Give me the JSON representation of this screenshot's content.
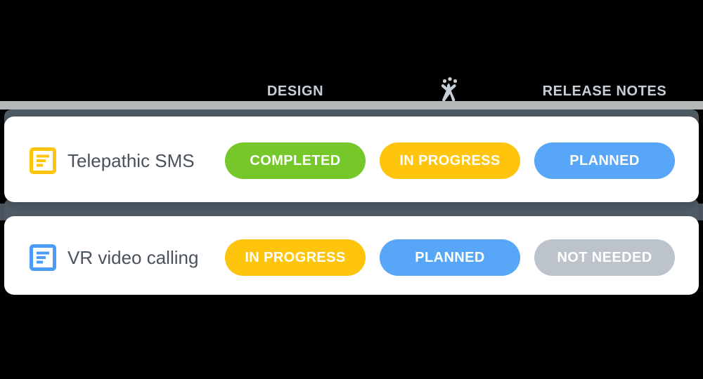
{
  "header": {
    "columns": [
      {
        "label": "DESIGN",
        "icon": "juggling-person-icon"
      },
      {
        "label": "",
        "icon": "juggling-person-icon"
      },
      {
        "label": "RELEASE NOTES",
        "icon": ""
      }
    ],
    "column_1_label": "DESIGN",
    "column_2_label": "",
    "column_3_label": "RELEASE NOTES",
    "center_icon_name": "juggling-person-icon",
    "text_color": "#c6ced6",
    "band_color": "#b5b8b9"
  },
  "theme": {
    "background": "#000000",
    "card_background": "#ffffff",
    "slate_bar": "#4e5a64",
    "title_color": "#4a525c",
    "status_completed": "#76c82a",
    "status_in_progress": "#ffc40c",
    "status_planned": "#57a6f7",
    "status_not_needed": "#bcc3cb"
  },
  "rows": [
    {
      "icon_name": "notes-document-icon",
      "icon_color": "#ffc40c",
      "title": "Telepathic SMS",
      "statuses": [
        {
          "label": "COMPLETED",
          "color": "#76c82a"
        },
        {
          "label": "IN PROGRESS",
          "color": "#ffc40c"
        },
        {
          "label": "PLANNED",
          "color": "#57a6f7"
        }
      ]
    },
    {
      "icon_name": "notes-document-icon",
      "icon_color": "#4a9cf6",
      "title": "VR video calling",
      "statuses": [
        {
          "label": "IN PROGRESS",
          "color": "#ffc40c"
        },
        {
          "label": "PLANNED",
          "color": "#57a6f7"
        },
        {
          "label": "NOT NEEDED",
          "color": "#bcc3cb"
        }
      ]
    }
  ]
}
